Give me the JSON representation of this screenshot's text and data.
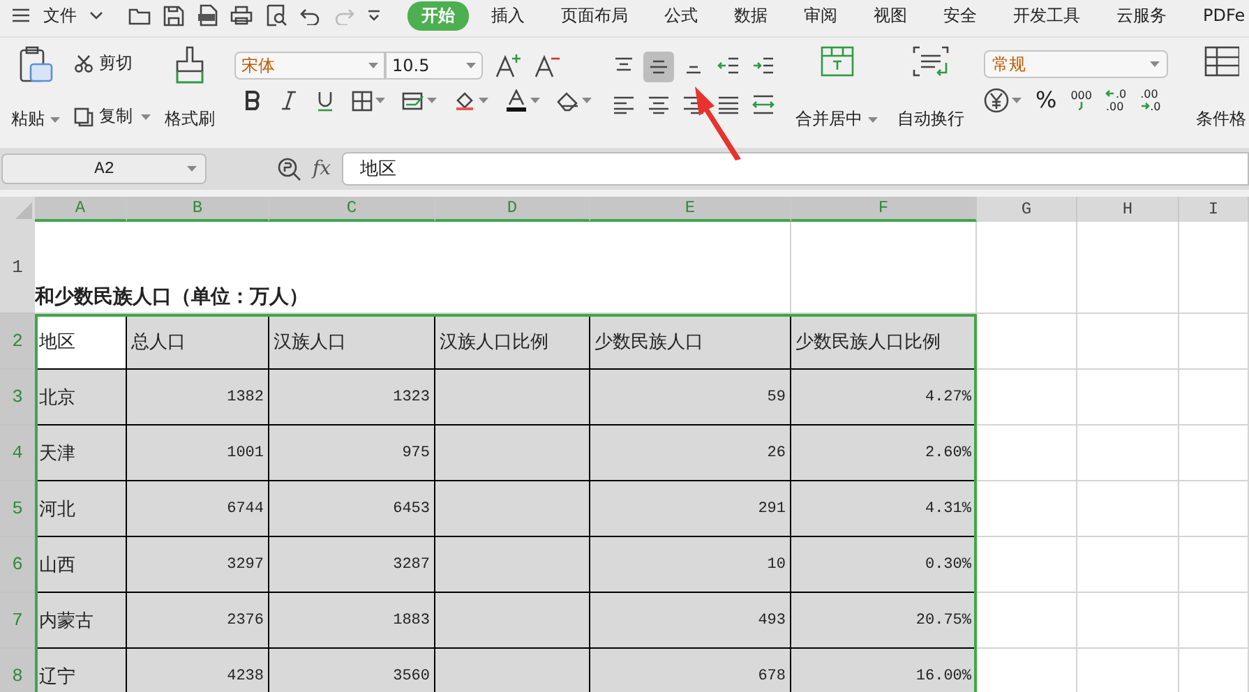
{
  "menu": {
    "file_label": "文件",
    "tabs": [
      {
        "label": "开始",
        "selected": true
      },
      {
        "label": "插入",
        "selected": false
      },
      {
        "label": "页面布局",
        "selected": false
      },
      {
        "label": "公式",
        "selected": false
      },
      {
        "label": "数据",
        "selected": false
      },
      {
        "label": "审阅",
        "selected": false
      },
      {
        "label": "视图",
        "selected": false
      },
      {
        "label": "安全",
        "selected": false
      },
      {
        "label": "开发工具",
        "selected": false
      },
      {
        "label": "云服务",
        "selected": false
      },
      {
        "label": "PDFe",
        "selected": false
      }
    ]
  },
  "ribbon": {
    "paste": "粘贴",
    "cut": "剪切",
    "copy": "复制",
    "format_painter": "格式刷",
    "font": "宋体",
    "font_size": "10.5",
    "vertical_align": [
      {
        "selected": false
      },
      {
        "selected": true
      },
      {
        "selected": false
      }
    ],
    "merge": "合并居中",
    "wrap": "自动换行",
    "number_format": "常规",
    "percent": "%",
    "thousands": "000",
    "increase_decimal": [
      ".0",
      ".00"
    ],
    "decrease_decimal": [
      ".00",
      ".0"
    ],
    "conditional": "条件格"
  },
  "formula_bar": {
    "cell_ref": "A2",
    "fx_label": "fx",
    "value": "地区"
  },
  "sheet": {
    "columns": [
      {
        "label": "A",
        "selected": true
      },
      {
        "label": "B",
        "selected": true
      },
      {
        "label": "C",
        "selected": true
      },
      {
        "label": "D",
        "selected": true
      },
      {
        "label": "E",
        "selected": true
      },
      {
        "label": "F",
        "selected": true
      },
      {
        "label": "G",
        "selected": false
      },
      {
        "label": "H",
        "selected": false
      },
      {
        "label": "I",
        "selected": false
      }
    ],
    "rows": [
      {
        "number": "1",
        "selected": false,
        "title": "和少数民族人口（单位：万人）"
      },
      {
        "number": "2",
        "selected": true,
        "cells": [
          {
            "kind": "text",
            "text": "地区",
            "selected": true,
            "active": true
          },
          {
            "kind": "text",
            "text": "总人口",
            "selected": true,
            "active": false
          },
          {
            "kind": "text",
            "text": "汉族人口",
            "selected": true,
            "active": false
          },
          {
            "kind": "text",
            "text": "汉族人口比例",
            "selected": true,
            "active": false
          },
          {
            "kind": "text",
            "text": "少数民族人口",
            "selected": true,
            "active": false
          },
          {
            "kind": "text",
            "text": "少数民族人口比例",
            "selected": true,
            "active": false
          }
        ]
      },
      {
        "number": "3",
        "selected": true,
        "cells": [
          {
            "kind": "text",
            "text": "北京",
            "selected": true,
            "active": false
          },
          {
            "kind": "number",
            "text": "1382",
            "selected": true,
            "active": false
          },
          {
            "kind": "number",
            "text": "1323",
            "selected": true,
            "active": false
          },
          {
            "kind": "empty",
            "selected": true,
            "active": false
          },
          {
            "kind": "number",
            "text": "59",
            "selected": true,
            "active": false
          },
          {
            "kind": "number",
            "text": "4.27%",
            "selected": true,
            "active": false
          }
        ]
      },
      {
        "number": "4",
        "selected": true,
        "cells": [
          {
            "kind": "text",
            "text": "天津",
            "selected": true,
            "active": false
          },
          {
            "kind": "number",
            "text": "1001",
            "selected": true,
            "active": false
          },
          {
            "kind": "number",
            "text": "975",
            "selected": true,
            "active": false
          },
          {
            "kind": "empty",
            "selected": true,
            "active": false
          },
          {
            "kind": "number",
            "text": "26",
            "selected": true,
            "active": false
          },
          {
            "kind": "number",
            "text": "2.60%",
            "selected": true,
            "active": false
          }
        ]
      },
      {
        "number": "5",
        "selected": true,
        "cells": [
          {
            "kind": "text",
            "text": "河北",
            "selected": true,
            "active": false
          },
          {
            "kind": "number",
            "text": "6744",
            "selected": true,
            "active": false
          },
          {
            "kind": "number",
            "text": "6453",
            "selected": true,
            "active": false
          },
          {
            "kind": "empty",
            "selected": true,
            "active": false
          },
          {
            "kind": "number",
            "text": "291",
            "selected": true,
            "active": false
          },
          {
            "kind": "number",
            "text": "4.31%",
            "selected": true,
            "active": false
          }
        ]
      },
      {
        "number": "6",
        "selected": true,
        "cells": [
          {
            "kind": "text",
            "text": "山西",
            "selected": true,
            "active": false
          },
          {
            "kind": "number",
            "text": "3297",
            "selected": true,
            "active": false
          },
          {
            "kind": "number",
            "text": "3287",
            "selected": true,
            "active": false
          },
          {
            "kind": "empty",
            "selected": true,
            "active": false
          },
          {
            "kind": "number",
            "text": "10",
            "selected": true,
            "active": false
          },
          {
            "kind": "number",
            "text": "0.30%",
            "selected": true,
            "active": false
          }
        ]
      },
      {
        "number": "7",
        "selected": true,
        "cells": [
          {
            "kind": "text",
            "text": "内蒙古",
            "selected": true,
            "active": false
          },
          {
            "kind": "number",
            "text": "2376",
            "selected": true,
            "active": false
          },
          {
            "kind": "number",
            "text": "1883",
            "selected": true,
            "active": false
          },
          {
            "kind": "empty",
            "selected": true,
            "active": false
          },
          {
            "kind": "number",
            "text": "493",
            "selected": true,
            "active": false
          },
          {
            "kind": "number",
            "text": "20.75%",
            "selected": true,
            "active": false
          }
        ]
      },
      {
        "number": "8",
        "selected": true,
        "cells": [
          {
            "kind": "text",
            "text": "辽宁",
            "selected": true,
            "active": false
          },
          {
            "kind": "number",
            "text": "4238",
            "selected": true,
            "active": false
          },
          {
            "kind": "number",
            "text": "3560",
            "selected": true,
            "active": false
          },
          {
            "kind": "empty",
            "selected": true,
            "active": false
          },
          {
            "kind": "number",
            "text": "678",
            "selected": true,
            "active": false
          },
          {
            "kind": "number",
            "text": "16.00%",
            "selected": true,
            "active": false
          }
        ]
      }
    ]
  }
}
